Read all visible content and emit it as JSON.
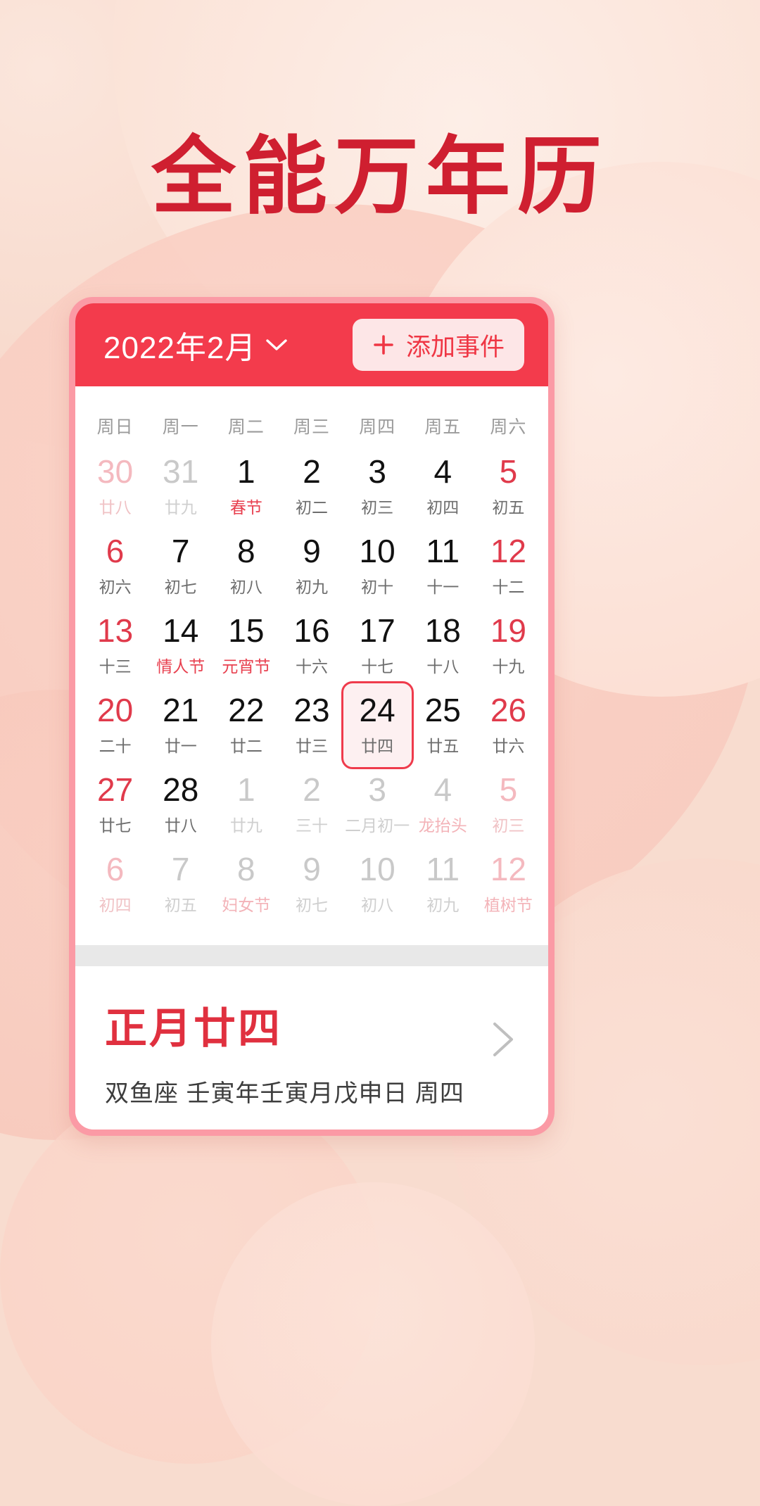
{
  "hero": {
    "title": "全能万年历",
    "title_color": "#cf1f30"
  },
  "theme": {
    "accent": "#f33b4c",
    "frame": "#fb9aa5",
    "background": "#f8dccf",
    "button_bg": "#fde6e7",
    "selected_border": "#ef3b4c",
    "weekend_text": "#e03a4b",
    "festival_text": "#e8404f"
  },
  "calendar": {
    "header": {
      "month_label": "2022年2月",
      "chevron_icon": "chevron-down-icon",
      "add_event": {
        "label": "添加事件",
        "icon": "plus-icon"
      }
    },
    "weekdays": [
      "周日",
      "周一",
      "周二",
      "周三",
      "周四",
      "周五",
      "周六"
    ],
    "days": [
      {
        "num": "30",
        "sub": "廿八",
        "out": true,
        "weekend": true,
        "fest": false,
        "selected": false
      },
      {
        "num": "31",
        "sub": "廿九",
        "out": true,
        "weekend": false,
        "fest": false,
        "selected": false
      },
      {
        "num": "1",
        "sub": "春节",
        "out": false,
        "weekend": false,
        "fest": true,
        "selected": false
      },
      {
        "num": "2",
        "sub": "初二",
        "out": false,
        "weekend": false,
        "fest": false,
        "selected": false
      },
      {
        "num": "3",
        "sub": "初三",
        "out": false,
        "weekend": false,
        "fest": false,
        "selected": false
      },
      {
        "num": "4",
        "sub": "初四",
        "out": false,
        "weekend": false,
        "fest": false,
        "selected": false
      },
      {
        "num": "5",
        "sub": "初五",
        "out": false,
        "weekend": true,
        "fest": false,
        "selected": false
      },
      {
        "num": "6",
        "sub": "初六",
        "out": false,
        "weekend": true,
        "fest": false,
        "selected": false
      },
      {
        "num": "7",
        "sub": "初七",
        "out": false,
        "weekend": false,
        "fest": false,
        "selected": false
      },
      {
        "num": "8",
        "sub": "初八",
        "out": false,
        "weekend": false,
        "fest": false,
        "selected": false
      },
      {
        "num": "9",
        "sub": "初九",
        "out": false,
        "weekend": false,
        "fest": false,
        "selected": false
      },
      {
        "num": "10",
        "sub": "初十",
        "out": false,
        "weekend": false,
        "fest": false,
        "selected": false
      },
      {
        "num": "11",
        "sub": "十一",
        "out": false,
        "weekend": false,
        "fest": false,
        "selected": false
      },
      {
        "num": "12",
        "sub": "十二",
        "out": false,
        "weekend": true,
        "fest": false,
        "selected": false
      },
      {
        "num": "13",
        "sub": "十三",
        "out": false,
        "weekend": true,
        "fest": false,
        "selected": false
      },
      {
        "num": "14",
        "sub": "情人节",
        "out": false,
        "weekend": false,
        "fest": true,
        "selected": false
      },
      {
        "num": "15",
        "sub": "元宵节",
        "out": false,
        "weekend": false,
        "fest": true,
        "selected": false
      },
      {
        "num": "16",
        "sub": "十六",
        "out": false,
        "weekend": false,
        "fest": false,
        "selected": false
      },
      {
        "num": "17",
        "sub": "十七",
        "out": false,
        "weekend": false,
        "fest": false,
        "selected": false
      },
      {
        "num": "18",
        "sub": "十八",
        "out": false,
        "weekend": false,
        "fest": false,
        "selected": false
      },
      {
        "num": "19",
        "sub": "十九",
        "out": false,
        "weekend": true,
        "fest": false,
        "selected": false
      },
      {
        "num": "20",
        "sub": "二十",
        "out": false,
        "weekend": true,
        "fest": false,
        "selected": false
      },
      {
        "num": "21",
        "sub": "廿一",
        "out": false,
        "weekend": false,
        "fest": false,
        "selected": false
      },
      {
        "num": "22",
        "sub": "廿二",
        "out": false,
        "weekend": false,
        "fest": false,
        "selected": false
      },
      {
        "num": "23",
        "sub": "廿三",
        "out": false,
        "weekend": false,
        "fest": false,
        "selected": false
      },
      {
        "num": "24",
        "sub": "廿四",
        "out": false,
        "weekend": false,
        "fest": false,
        "selected": true
      },
      {
        "num": "25",
        "sub": "廿五",
        "out": false,
        "weekend": false,
        "fest": false,
        "selected": false
      },
      {
        "num": "26",
        "sub": "廿六",
        "out": false,
        "weekend": true,
        "fest": false,
        "selected": false
      },
      {
        "num": "27",
        "sub": "廿七",
        "out": false,
        "weekend": true,
        "fest": false,
        "selected": false
      },
      {
        "num": "28",
        "sub": "廿八",
        "out": false,
        "weekend": false,
        "fest": false,
        "selected": false
      },
      {
        "num": "1",
        "sub": "廿九",
        "out": true,
        "weekend": false,
        "fest": false,
        "selected": false
      },
      {
        "num": "2",
        "sub": "三十",
        "out": true,
        "weekend": false,
        "fest": false,
        "selected": false
      },
      {
        "num": "3",
        "sub": "二月初一",
        "out": true,
        "weekend": false,
        "fest": false,
        "selected": false
      },
      {
        "num": "4",
        "sub": "龙抬头",
        "out": true,
        "weekend": false,
        "fest": true,
        "selected": false
      },
      {
        "num": "5",
        "sub": "初三",
        "out": true,
        "weekend": true,
        "fest": false,
        "selected": false
      },
      {
        "num": "6",
        "sub": "初四",
        "out": true,
        "weekend": true,
        "fest": false,
        "selected": false
      },
      {
        "num": "7",
        "sub": "初五",
        "out": true,
        "weekend": false,
        "fest": false,
        "selected": false
      },
      {
        "num": "8",
        "sub": "妇女节",
        "out": true,
        "weekend": false,
        "fest": true,
        "selected": false
      },
      {
        "num": "9",
        "sub": "初七",
        "out": true,
        "weekend": false,
        "fest": false,
        "selected": false
      },
      {
        "num": "10",
        "sub": "初八",
        "out": true,
        "weekend": false,
        "fest": false,
        "selected": false
      },
      {
        "num": "11",
        "sub": "初九",
        "out": true,
        "weekend": false,
        "fest": false,
        "selected": false
      },
      {
        "num": "12",
        "sub": "植树节",
        "out": true,
        "weekend": true,
        "fest": true,
        "selected": false
      }
    ]
  },
  "detail": {
    "lunar_title": "正月廿四",
    "sub_line": "双鱼座  壬寅年壬寅月戊申日  周四",
    "chevron_icon": "chevron-right-icon"
  }
}
